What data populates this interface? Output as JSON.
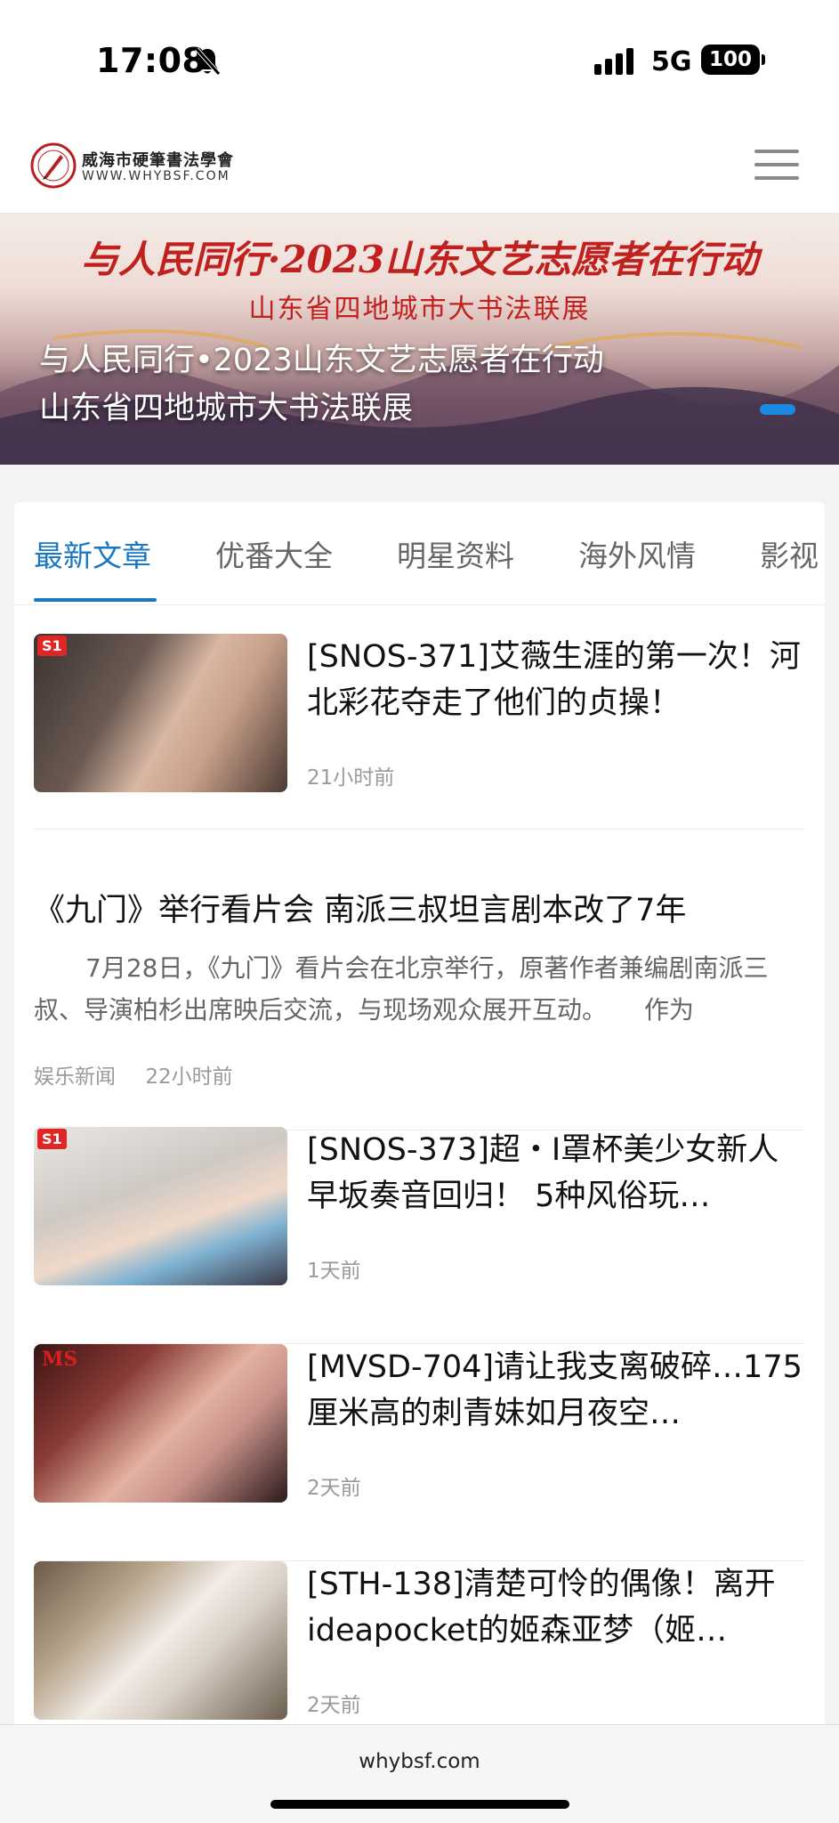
{
  "status": {
    "time": "17:08",
    "network": "5G",
    "battery": "100",
    "icons": [
      "bell-slash-icon",
      "signal-icon",
      "battery-icon"
    ]
  },
  "header": {
    "site_name": "威海市硬筆書法學會",
    "site_url": "WWW.WHYBSF.COM",
    "menu_icon": "hamburger-menu-icon"
  },
  "banner": {
    "headline": "与人民同行·2023山东文艺志愿者在行动",
    "subline": "山东省四地城市大书法联展",
    "caption_line1": "与人民同行•2023山东文艺志愿者在行动",
    "caption_line2": "山东省四地城市大书法联展",
    "accent_color": "#1a8be0"
  },
  "tabs": [
    {
      "label": "最新文章",
      "active": true
    },
    {
      "label": "优番大全",
      "active": false
    },
    {
      "label": "明星资料",
      "active": false
    },
    {
      "label": "海外风情",
      "active": false
    },
    {
      "label": "影视",
      "active": false
    }
  ],
  "articles": [
    {
      "badge": "S1",
      "title": "[SNOS-371]艾薇生涯的第一次！河北彩花夺走了他们的贞操！",
      "time": "21小时前"
    },
    {
      "badge": "S1",
      "title": "[SNOS-373]超・I罩杯美少女新人早坂奏音回归！ 5种风俗玩…",
      "time": "1天前"
    },
    {
      "badge": "MS",
      "title": "[MVSD-704]请让我支离破碎…175厘米高的刺青妹如月夜空…",
      "time": "2天前"
    },
    {
      "badge": "",
      "title": "[STH-138]清楚可怜的偶像！离开ideapocket的姬森亚梦（姬…",
      "time": "2天前"
    }
  ],
  "text_article": {
    "title": "《九门》举行看片会 南派三叔坦言剧本改了7年",
    "excerpt": "7月28日，《九门》看片会在北京举行，原著作者兼编剧南派三叔、导演柏杉出席映后交流，与现场观众展开互动。　　作为",
    "category": "娱乐新闻",
    "time": "22小时前"
  },
  "browser": {
    "url": "whybsf.com"
  },
  "colors": {
    "accent": "#1a78c2",
    "muted_text": "#9a9a9a"
  }
}
